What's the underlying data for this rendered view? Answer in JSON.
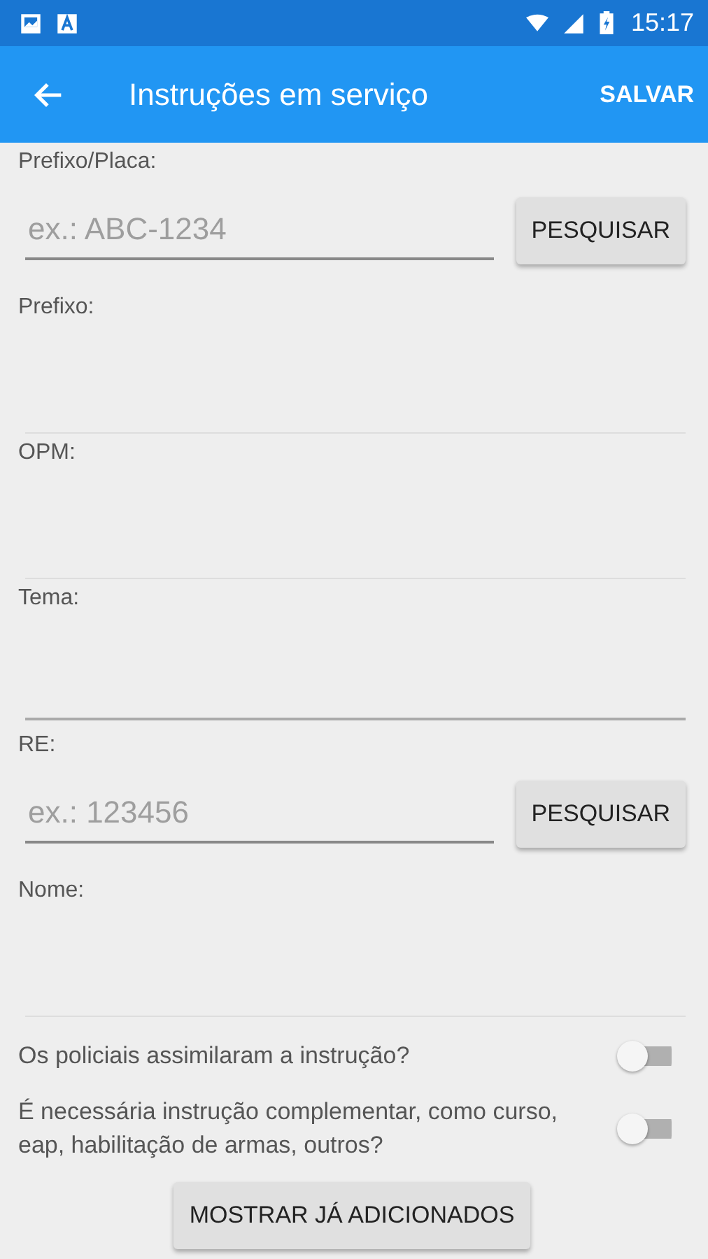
{
  "status_bar": {
    "time": "15:17"
  },
  "app_bar": {
    "title": "Instruções em serviço",
    "action": "SALVAR"
  },
  "fields": [
    {
      "kind": "search",
      "label": "Prefixo/Placa:",
      "placeholder": "ex.: ABC-1234",
      "button": "PESQUISAR"
    },
    {
      "kind": "display",
      "label": "Prefixo:"
    },
    {
      "kind": "display",
      "label": "OPM:"
    },
    {
      "kind": "text",
      "label": "Tema:"
    },
    {
      "kind": "search",
      "label": "RE:",
      "placeholder": "ex.: 123456",
      "button": "PESQUISAR"
    },
    {
      "kind": "display",
      "label": "Nome:"
    }
  ],
  "toggles": [
    {
      "label": "Os policiais assimilaram a instrução?",
      "on": false
    },
    {
      "label": "É necessária instrução complementar, como curso, eap, habilitação de armas, outros?",
      "on": false
    }
  ],
  "button": "MOSTRAR JÁ ADICIONADOS"
}
